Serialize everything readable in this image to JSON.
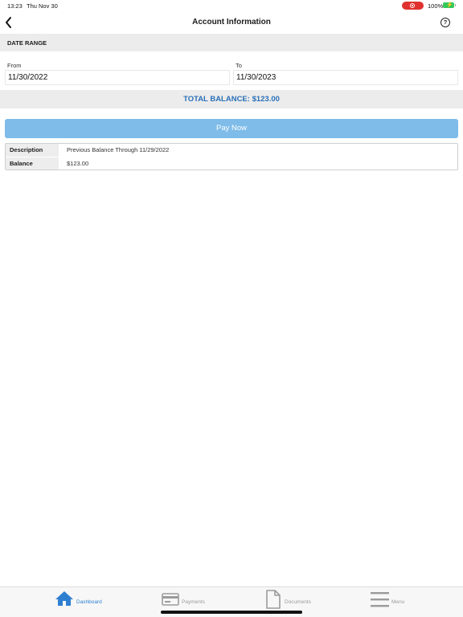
{
  "status_bar": {
    "time": "13:23",
    "date": "Thu Nov 30",
    "battery": "100%"
  },
  "nav": {
    "title": "Account Information",
    "help": "?"
  },
  "date_range": {
    "header": "DATE RANGE",
    "from_label": "From",
    "from_value": "11/30/2022",
    "to_label": "To",
    "to_value": "11/30/2023"
  },
  "total_balance": "TOTAL BALANCE: $123.00",
  "pay_now": "Pay Now",
  "details": [
    {
      "key": "Description",
      "value": "Previous Balance Through 11/29/2022"
    },
    {
      "key": "Balance",
      "value": "$123.00"
    }
  ],
  "tabs": [
    {
      "label": "Dashboard",
      "icon": "home-icon",
      "active": true
    },
    {
      "label": "Payments",
      "icon": "credit-card-icon",
      "active": false
    },
    {
      "label": "Documents",
      "icon": "document-icon",
      "active": false
    },
    {
      "label": "Menu",
      "icon": "menu-icon",
      "active": false
    }
  ],
  "colors": {
    "accent": "#2a70b8",
    "pay_button": "#7fbce9",
    "tab_active": "#2f7fd1",
    "tab_inactive": "#9b9b9b",
    "record_indicator": "#e0312f",
    "battery": "#34c759"
  }
}
